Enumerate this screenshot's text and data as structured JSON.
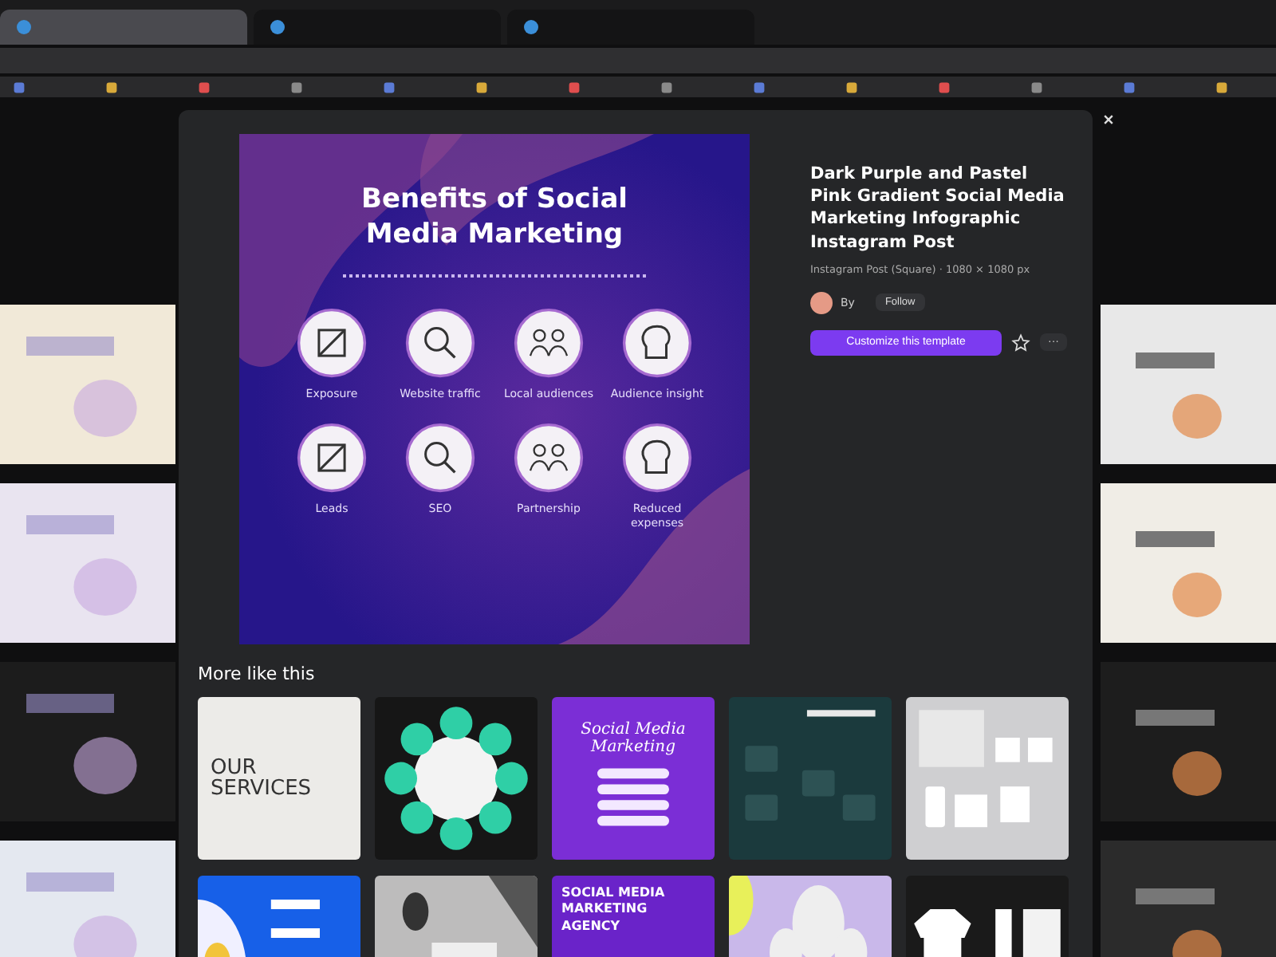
{
  "browser": {
    "tabs": [
      {
        "selected": true
      },
      {
        "selected": false
      },
      {
        "selected": false
      }
    ]
  },
  "template": {
    "heading": "Benefits of Social Media Marketing",
    "items": [
      {
        "label": "Exposure"
      },
      {
        "label": "Website traffic"
      },
      {
        "label": "Local audiences"
      },
      {
        "label": "Audience insight"
      },
      {
        "label": "Leads"
      },
      {
        "label": "SEO"
      },
      {
        "label": "Partnership"
      },
      {
        "label": "Reduced expenses"
      }
    ]
  },
  "details": {
    "title": "Dark Purple and Pastel Pink Gradient Social Media Marketing Infographic Instagram Post",
    "meta": "Instagram Post (Square) · 1080 × 1080 px",
    "author": "By",
    "follow": "Follow",
    "customize": "Customize this template",
    "more": "···"
  },
  "more_like_this": {
    "heading": "More like this",
    "tiles": [
      {
        "kind": "services",
        "text": "OUR SERVICES"
      },
      {
        "kind": "ring"
      },
      {
        "kind": "purple-list",
        "text": "Social Media Marketing"
      },
      {
        "kind": "teal"
      },
      {
        "kind": "mockup"
      },
      {
        "kind": "blue"
      },
      {
        "kind": "grey"
      },
      {
        "kind": "agency",
        "text": "SOCIAL MEDIA MARKETING AGENCY"
      },
      {
        "kind": "lavender"
      },
      {
        "kind": "merch"
      }
    ]
  }
}
